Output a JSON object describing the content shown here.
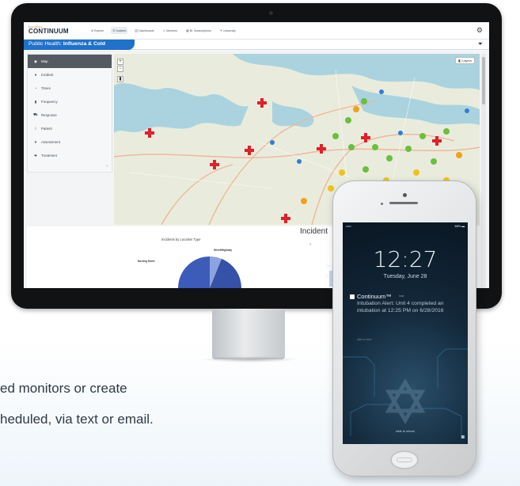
{
  "app": {
    "brand_small": "EmergenSee",
    "brand": "CONTINUUM",
    "nav": [
      {
        "label": "Explore",
        "icon": "compass-icon"
      },
      {
        "label": "Incident",
        "icon": "list-icon",
        "active": true
      },
      {
        "label": "Dashboards",
        "icon": "chart-icon"
      },
      {
        "label": "Monitors",
        "icon": "bell-icon"
      },
      {
        "label": "BI, Subscriptions",
        "icon": "grid-icon"
      },
      {
        "label": "University",
        "icon": "cap-icon"
      }
    ],
    "settings_icon": "gear-icon",
    "filter_icon": "filter-icon"
  },
  "dashboard": {
    "title_prefix": "Public Health:",
    "title_name": "Influenza & Cold"
  },
  "sidebar": {
    "items": [
      {
        "label": "Map",
        "icon": "map-icon",
        "active": true
      },
      {
        "label": "Incident",
        "icon": "incident-icon"
      },
      {
        "label": "Times",
        "icon": "clock-icon"
      },
      {
        "label": "Frequency",
        "icon": "frequency-icon"
      },
      {
        "label": "Response",
        "icon": "response-icon"
      },
      {
        "label": "Patient",
        "icon": "patient-icon"
      },
      {
        "label": "Assessment",
        "icon": "assessment-icon"
      },
      {
        "label": "Treatment",
        "icon": "treatment-icon"
      }
    ],
    "collapse_icon": "chevron-left-icon"
  },
  "map": {
    "layers_label": "Layers",
    "zoom_in": "+",
    "zoom_out": "−"
  },
  "lower": {
    "pie_title": "Incidents by Location Type",
    "pie_labels": [
      "Street/Highway",
      "Nursing Home"
    ],
    "incident_title": "Incident"
  },
  "phone": {
    "status": {
      "carrier": "•••••",
      "time": "",
      "battery": "88% ▬"
    },
    "lock_time": "12:27",
    "lock_date": "Tuesday, June 28",
    "notification": {
      "app": "Continuum™",
      "when": "now",
      "body": "Intubation Alert: Unit 4 completed an intubation at 12:25 PM on 6/28/2016",
      "action": "slide to view"
    },
    "slide_text": "slide to unlock",
    "camera_icon": "camera-icon"
  },
  "copy": {
    "line1": "ed monitors or create",
    "line2": "heduled, via text or email."
  },
  "colors": {
    "accent": "#1f71c9",
    "cross": "#e0202a",
    "pin": "#2f7fd6",
    "cluster_green": "#6bbf3d",
    "cluster_yellow": "#f1c21a",
    "cluster_orange": "#f0a11e"
  }
}
